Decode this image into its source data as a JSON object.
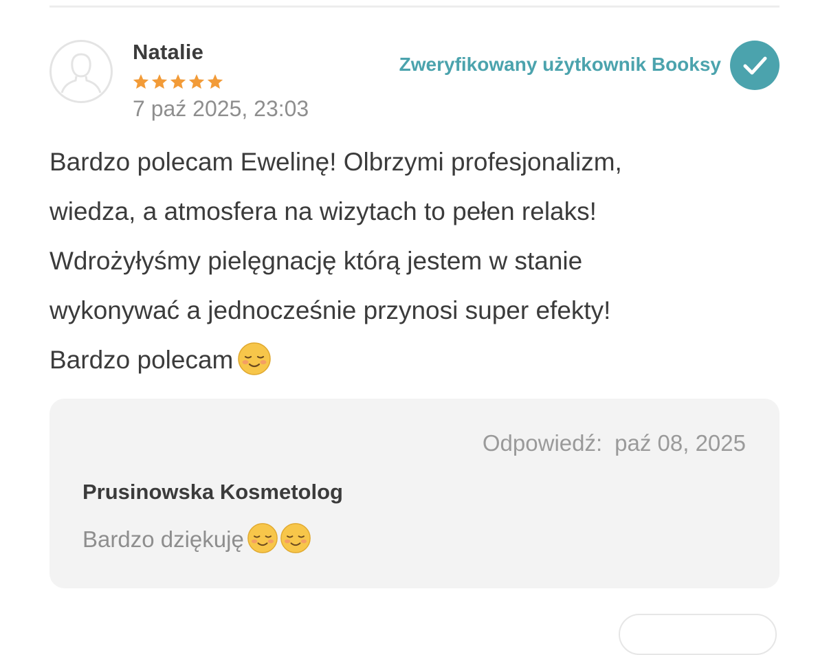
{
  "review": {
    "reviewer_name": "Natalie",
    "rating": 5,
    "rating_max": 5,
    "date": "7 paź 2025, 23:03",
    "verified_label": "Zweryfikowany użytkownik Booksy",
    "body_lines": [
      "Bardzo polecam Ewelinę! Olbrzymi profesjonalizm,",
      "wiedza, a atmosfera na wizytach to pełen relaks!",
      "Wdrożyłyśmy pielęgnację którą jestem w stanie",
      "wykonywać a jednocześnie przynosi super efekty!",
      "Bardzo polecam"
    ],
    "body_end_emoji": "smiling-face-icon"
  },
  "reply": {
    "date_label": "Odpowiedź:",
    "date": "paź 08, 2025",
    "author": "Prusinowska Kosmetolog",
    "text": "Bardzo dziękuję",
    "emoji_count": 2
  },
  "colors": {
    "accent": "#4ba3ad",
    "star": "#f29b38",
    "text": "#3b3b3b",
    "muted": "#8e8e8e",
    "reply_bg": "#f3f3f3"
  }
}
